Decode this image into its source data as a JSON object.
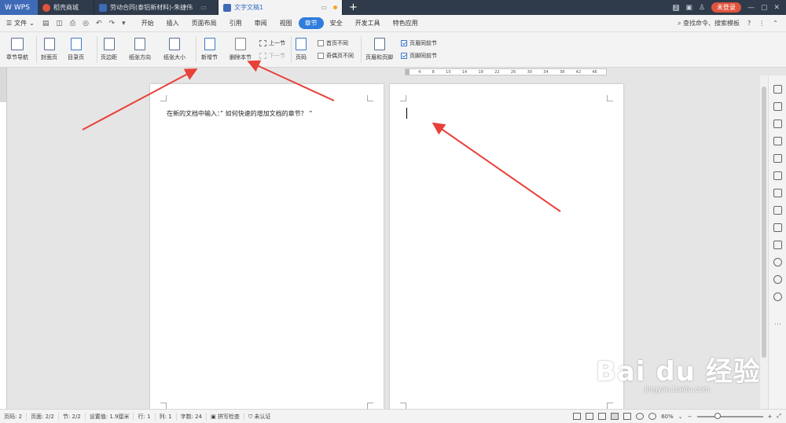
{
  "titlebar": {
    "logo": "WPS",
    "tabs": [
      {
        "label": "稻壳商城",
        "color": "#e0533c"
      },
      {
        "label": "劳动合同(泰铝新材料)-朱捷伟",
        "color": "#3e6ab8"
      },
      {
        "label": "文字文稿1",
        "color": "#3e6ab8"
      }
    ],
    "new_tab": "+",
    "badge_num": "2",
    "login": "未登录"
  },
  "menubar": {
    "file": "文件",
    "tabs": [
      "开始",
      "插入",
      "页面布局",
      "引用",
      "审阅",
      "视图",
      "章节",
      "安全",
      "开发工具",
      "特色应用"
    ],
    "active_tab": "章节",
    "search": "查找命令、搜索模板",
    "help": "?"
  },
  "ribbon": {
    "section_nav": "章节导航",
    "cover": "封面页",
    "toc": "目录页",
    "margin": "页边距",
    "orientation": "纸张方向",
    "size": "纸张大小",
    "new_section": "新增节",
    "delete_section": "删除本节",
    "prev_section": "上一节",
    "next_section": "下一节",
    "page_num": "页码",
    "first_diff": "首页不同",
    "odd_even_diff": "奇偶页不同",
    "header_footer": "页眉和页脚",
    "header_same": "页眉同前节",
    "footer_same": "页脚同前节"
  },
  "ruler": {
    "marks": [
      "4",
      "8",
      "10",
      "14",
      "18",
      "22",
      "26",
      "30",
      "34",
      "38",
      "42",
      "46"
    ]
  },
  "document": {
    "page1_text": "在新的文档中输入：” 如何快速的增加文档的章节？ ”"
  },
  "statusbar": {
    "page": "页码: 2",
    "pages": "页面: 2/2",
    "section": "节: 2/2",
    "setting": "设置值: 1.9厘米",
    "row": "行: 1",
    "col": "列: 1",
    "words": "字数: 24",
    "spell": "拼写检查",
    "cert": "未认证",
    "zoom": "60%"
  },
  "watermark": {
    "main": "Bai du 经验",
    "sub": "jingyan.baidu.com"
  },
  "colors": {
    "accent": "#2f7ddc",
    "arrow": "#e8403a",
    "titlebar": "#2f3a4a"
  }
}
